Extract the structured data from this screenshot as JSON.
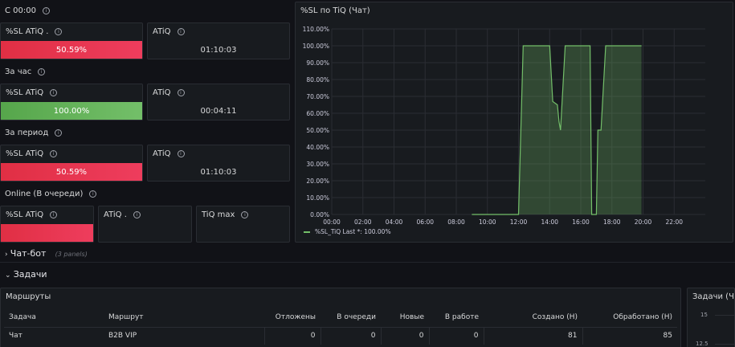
{
  "rows": {
    "since_midnight": "С 00:00",
    "per_hour": "За час",
    "per_period": "За период",
    "online": "Online (В очереди)"
  },
  "stats": {
    "sl1_title": "%SL ATiQ .",
    "sl1_value": "50.59%",
    "atiq1_title": "ATiQ",
    "atiq1_value": "01:10:03",
    "sl2_title": "%SL ATiQ",
    "sl2_value": "100.00%",
    "atiq2_title": "ATiQ",
    "atiq2_value": "00:04:11",
    "sl3_title": "%SL ATiQ",
    "sl3_value": "50.59%",
    "atiq3_title": "ATiQ",
    "atiq3_value": "01:10:03",
    "sl4_title": "%SL ATiQ",
    "atiq4_title": "ATiQ .",
    "tiq_title": "TiQ max"
  },
  "colors": {
    "red": "#e02f44",
    "green": "#73bf69",
    "bg": "#111217",
    "panel": "#181b1f"
  },
  "chart_data": {
    "type": "area",
    "title": "%SL по TiQ (Чат)",
    "x_ticks": [
      "00:00",
      "02:00",
      "04:00",
      "06:00",
      "08:00",
      "10:00",
      "12:00",
      "14:00",
      "16:00",
      "18:00",
      "20:00",
      "22:00"
    ],
    "y_ticks": [
      "0.00%",
      "10.00%",
      "20.00%",
      "30.00%",
      "40.00%",
      "50.00%",
      "60.00%",
      "70.00%",
      "80.00%",
      "90.00%",
      "100.00%",
      "110.00%"
    ],
    "ylim": [
      0,
      110
    ],
    "xlim_hours": [
      0,
      24
    ],
    "grid": true,
    "legend": "bottom-left",
    "series": [
      {
        "name": "%SL_TiQ",
        "legend_text": "%SL_TiQ  Last *: 100.00%",
        "color": "#73bf69",
        "x": [
          9.0,
          12.0,
          12.3,
          14.0,
          14.2,
          14.5,
          14.6,
          14.7,
          15.0,
          16.6,
          16.7,
          17.0,
          17.1,
          17.3,
          17.6,
          19.9
        ],
        "y": [
          0,
          0,
          100,
          100,
          67,
          65,
          55,
          50,
          100,
          100,
          0,
          0,
          50,
          50,
          100,
          100
        ]
      }
    ]
  },
  "collapsed_row": {
    "title": "Чат-бот",
    "panels": "(3 panels)"
  },
  "expanded_row": {
    "title": "Задачи"
  },
  "routes": {
    "title": "Маршруты",
    "columns": [
      "Задача",
      "Маршрут",
      "Отложены",
      "В очереди",
      "Новые",
      "В работе",
      "Создано (Н)",
      "Обработано (Н)"
    ],
    "rows": [
      [
        "Чат",
        "B2B VIP",
        "0",
        "0",
        "0",
        "0",
        "81",
        "85"
      ]
    ]
  },
  "tasks_panel": {
    "title": "Задачи (Ча",
    "y_ticks": [
      "15",
      "12.5"
    ]
  }
}
